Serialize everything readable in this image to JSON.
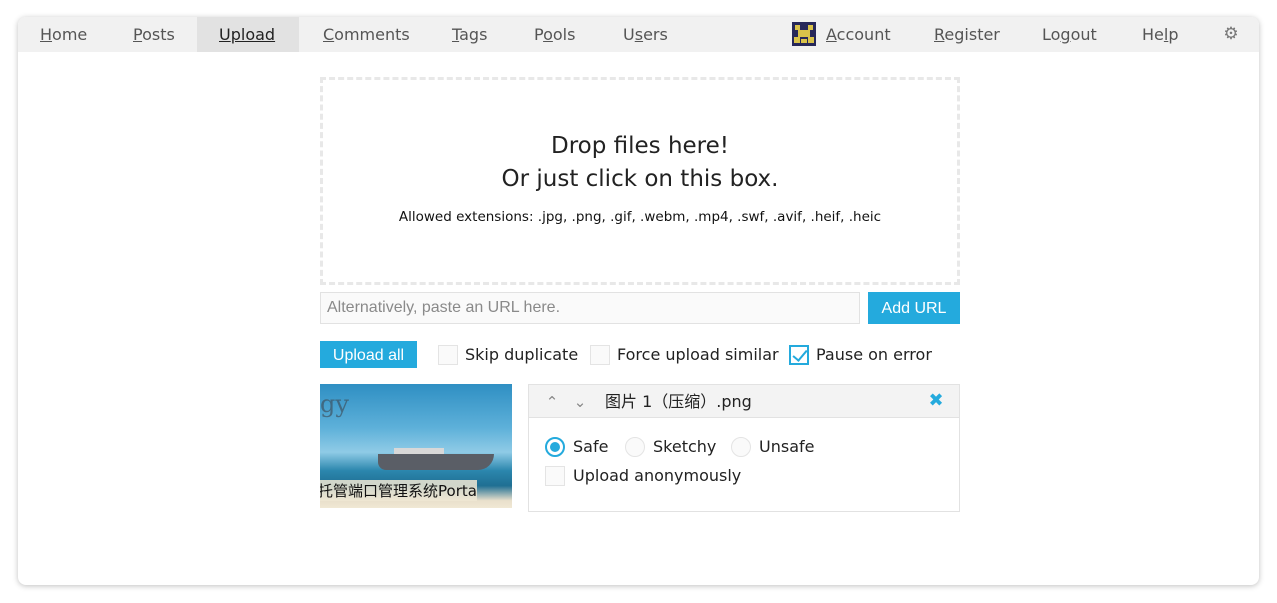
{
  "nav": {
    "home": {
      "accel": "H",
      "rest": "ome"
    },
    "posts": {
      "accel": "P",
      "rest": "osts"
    },
    "upload": {
      "accel": "U",
      "rest": "pload"
    },
    "comments": {
      "accel": "C",
      "rest": "omments"
    },
    "tags": {
      "accel": "T",
      "rest": "ags"
    },
    "pools": {
      "pre": "P",
      "accel": "o",
      "rest": "ols"
    },
    "users": {
      "pre": "U",
      "accel": "s",
      "rest": "ers"
    },
    "account": {
      "accel": "A",
      "rest": "ccount"
    },
    "register": {
      "accel": "R",
      "rest": "egister"
    },
    "logout": {
      "pre": "Lo",
      "accel": "g",
      "rest": "out"
    },
    "help": {
      "pre": "He",
      "accel": "l",
      "rest": "p"
    },
    "settings_icon": "gear-icon",
    "active": "upload"
  },
  "dropzone": {
    "line1": "Drop files here!",
    "line2": "Or just click on this box.",
    "extensions": "Allowed extensions: .jpg, .png, .gif, .webm, .mp4, .swf, .avif, .heif, .heic"
  },
  "url_input": {
    "placeholder": "Alternatively, paste an URL here.",
    "value": ""
  },
  "buttons": {
    "add_url": "Add URL",
    "upload_all": "Upload all"
  },
  "options": {
    "skip_duplicate": {
      "label": "Skip duplicate",
      "checked": false
    },
    "force_upload_similar": {
      "label": "Force upload similar",
      "checked": false
    },
    "pause_on_error": {
      "label": "Pause on error",
      "checked": true
    }
  },
  "upload_item": {
    "file_name": "图片 1（压缩）.png",
    "thumbnail_text_top": "gy",
    "thumbnail_text_bottom": "托管端口管理系统Porta",
    "safety": {
      "safe": "Safe",
      "sketchy": "Sketchy",
      "unsafe": "Unsafe",
      "selected": "safe"
    },
    "anonymous": {
      "label": "Upload anonymously",
      "checked": false
    }
  },
  "colors": {
    "accent": "#24aadd",
    "nav_bg": "#f1f1f1",
    "nav_active_bg": "#e2e2e2"
  }
}
